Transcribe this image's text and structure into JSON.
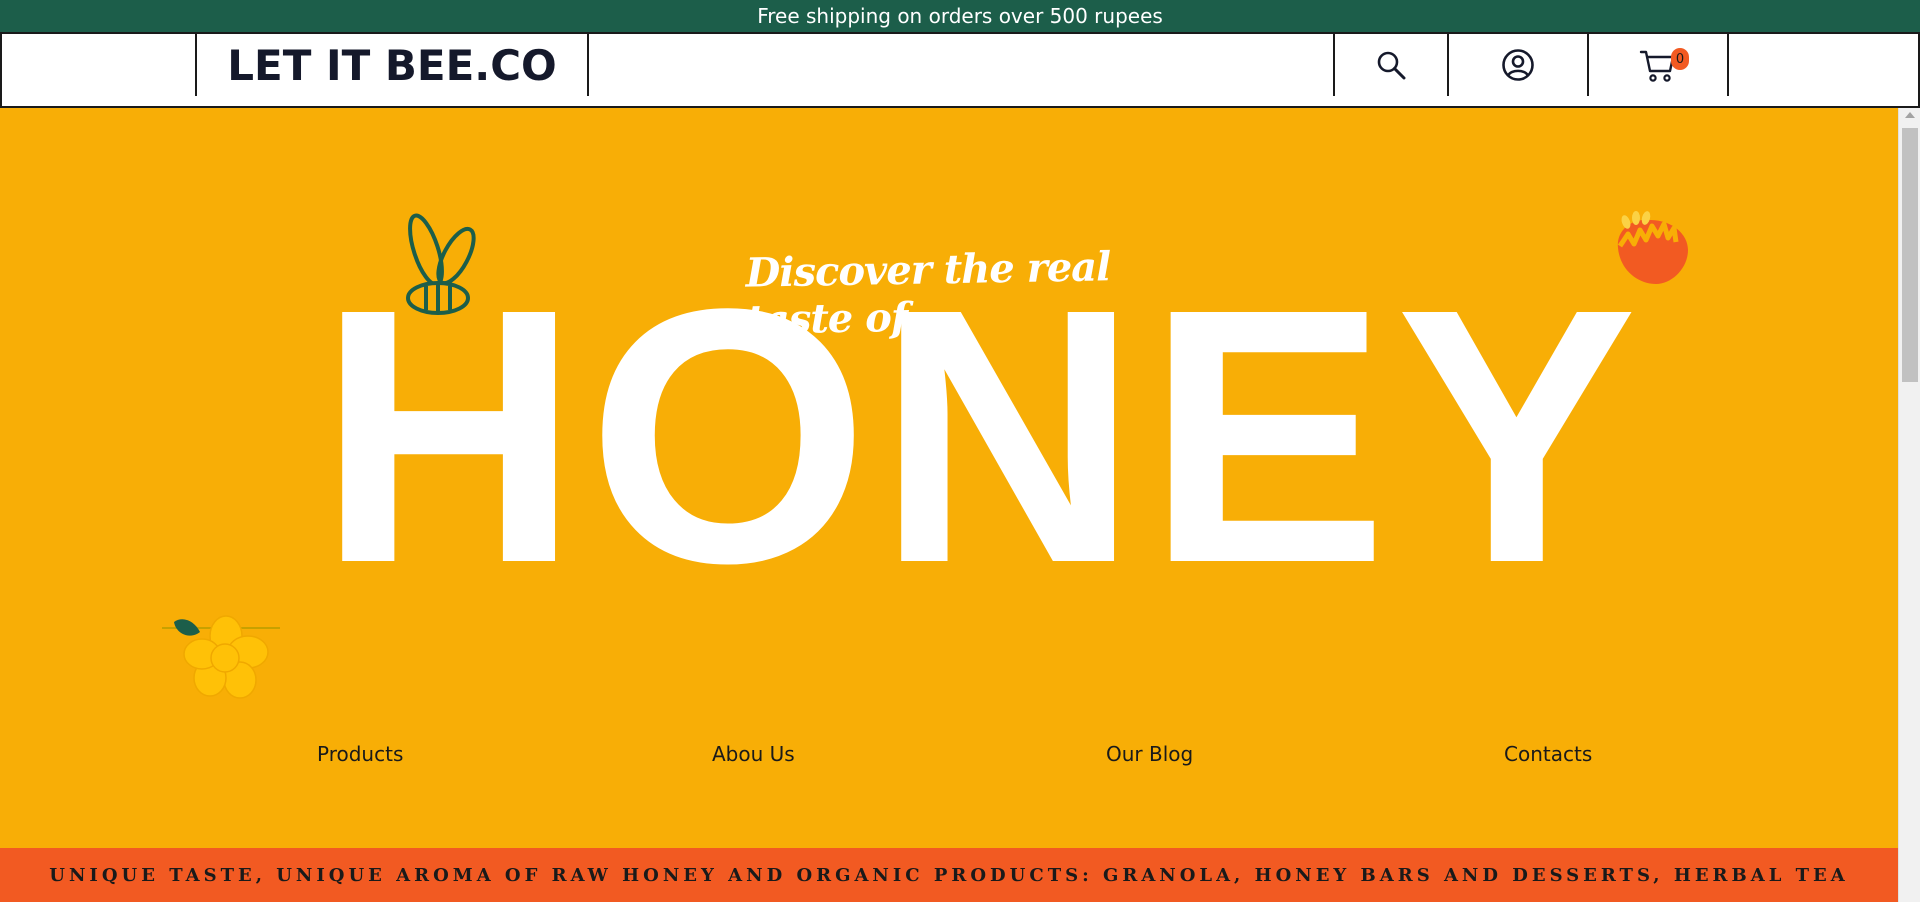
{
  "announcement": {
    "text": "Free shipping on orders over 500 rupees"
  },
  "header": {
    "logo": "LET IT BEE.CO",
    "icons": {
      "search": "search-icon",
      "account": "account-icon",
      "cart": "cart-icon"
    },
    "cart_count": "0"
  },
  "hero": {
    "tagline": "Discover the real taste of",
    "headline": "HONEY",
    "decorations": [
      "bee-icon",
      "flower-icon",
      "flower-icon"
    ]
  },
  "nav": {
    "items": [
      {
        "label": "Products"
      },
      {
        "label": "Abou Us"
      },
      {
        "label": "Our Blog"
      },
      {
        "label": "Contacts"
      }
    ]
  },
  "ticker": {
    "text": "UNIQUE TASTE, UNIQUE AROMA OF RAW HONEY AND ORGANIC PRODUCTS: GRANOLA, HONEY BARS AND DESSERTS, HERBAL TEA"
  },
  "colors": {
    "announcement_bg": "#1c5e4a",
    "hero_bg": "#f8ae06",
    "ticker_bg": "#f25a22",
    "badge_bg": "#f25a22",
    "text_dark": "#15192b",
    "white": "#ffffff"
  }
}
